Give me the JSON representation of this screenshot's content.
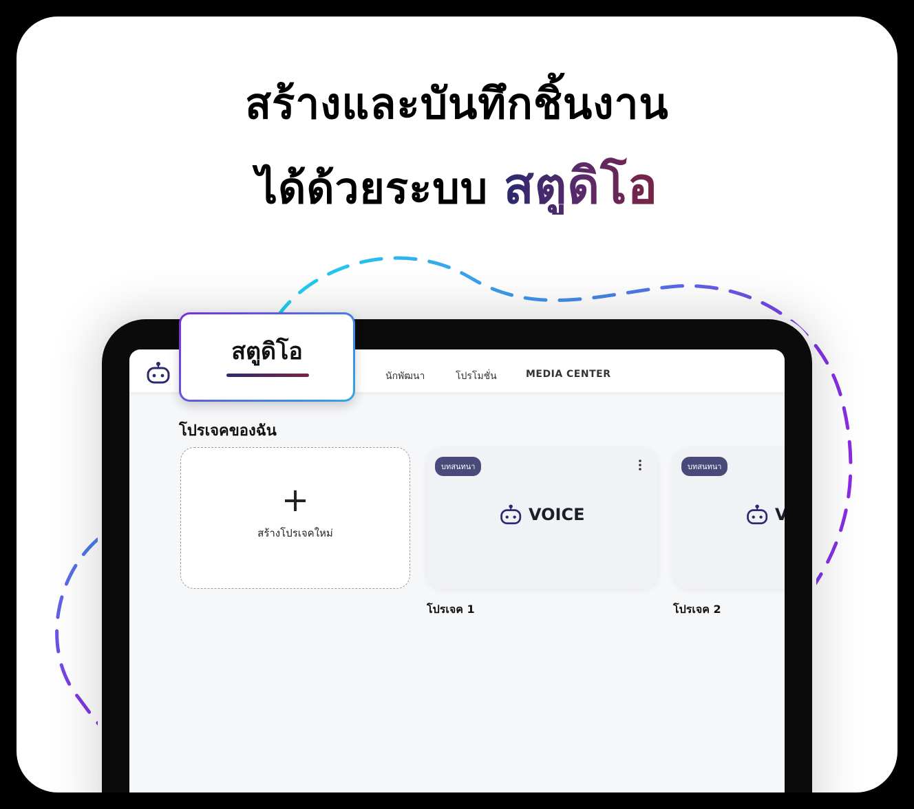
{
  "headline": {
    "line1": "สร้างและบันทึกชิ้นงาน",
    "line2_prefix": "ได้ด้วยระบบ",
    "line2_accent": "สตูดิโอ"
  },
  "colors": {
    "accent_start": "#2b2a6e",
    "accent_end": "#7a2444",
    "tag_bg": "#4a4a7a",
    "dash_cyan": "#1fd3f0",
    "dash_purple": "#8a2be2"
  },
  "popup": {
    "label": "สตูดิโอ"
  },
  "nav": {
    "items": [
      "นักพัฒนา",
      "โปรโมชั่น",
      "MEDIA CENTER"
    ]
  },
  "main": {
    "section_title": "โปรเจคของฉัน",
    "new_project": {
      "icon": "plus-icon",
      "label": "สร้างโปรเจคใหม่"
    },
    "projects": [
      {
        "tag": "บทสนทนา",
        "logo_text": "VOICE",
        "name": "โปรเจค 1"
      },
      {
        "tag": "บทสนทนา",
        "logo_text": "VOICE",
        "name": "โปรเจค 2"
      }
    ]
  }
}
